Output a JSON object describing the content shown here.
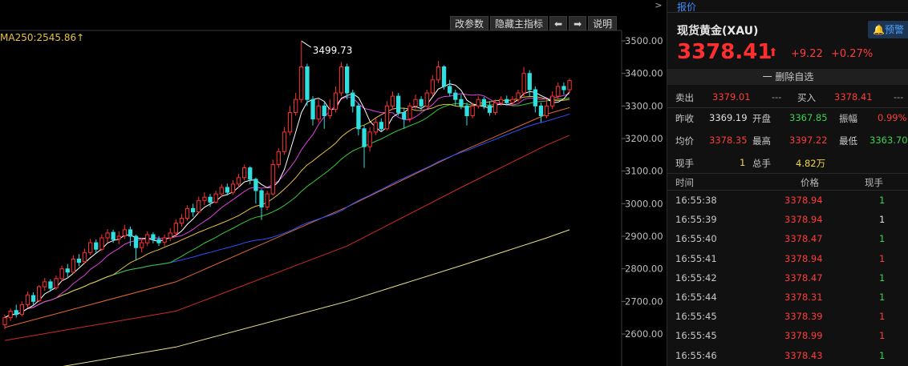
{
  "toolbar": {
    "buttons": [
      "改参数",
      "隐藏主指标",
      "⬅",
      "➡",
      "说明"
    ]
  },
  "ma_label": "MA250:2545.86↑",
  "max_label": "3499.73",
  "chart_data": {
    "type": "candlestick",
    "title": "",
    "yticks": [
      2600,
      2700,
      2800,
      2900,
      3000,
      3100,
      3200,
      3300,
      3400,
      3500
    ],
    "ylim": [
      2500,
      3540
    ],
    "max_marker": 3499.73,
    "candles": [
      [
        2628,
        2650,
        2615,
        2660
      ],
      [
        2650,
        2670,
        2640,
        2678
      ],
      [
        2672,
        2660,
        2650,
        2690
      ],
      [
        2660,
        2690,
        2655,
        2700
      ],
      [
        2690,
        2720,
        2680,
        2730
      ],
      [
        2718,
        2700,
        2690,
        2728
      ],
      [
        2702,
        2745,
        2698,
        2750
      ],
      [
        2745,
        2760,
        2732,
        2772
      ],
      [
        2760,
        2740,
        2730,
        2768
      ],
      [
        2742,
        2770,
        2735,
        2780
      ],
      [
        2770,
        2800,
        2762,
        2810
      ],
      [
        2800,
        2790,
        2775,
        2815
      ],
      [
        2790,
        2830,
        2785,
        2842
      ],
      [
        2830,
        2820,
        2808,
        2845
      ],
      [
        2822,
        2850,
        2815,
        2862
      ],
      [
        2850,
        2880,
        2842,
        2892
      ],
      [
        2880,
        2860,
        2850,
        2890
      ],
      [
        2860,
        2895,
        2855,
        2905
      ],
      [
        2895,
        2910,
        2880,
        2922
      ],
      [
        2912,
        2890,
        2880,
        2920
      ],
      [
        2892,
        2900,
        2875,
        2915
      ],
      [
        2902,
        2920,
        2892,
        2935
      ],
      [
        2920,
        2900,
        2870,
        2930
      ],
      [
        2900,
        2865,
        2825,
        2905
      ],
      [
        2865,
        2880,
        2850,
        2895
      ],
      [
        2880,
        2905,
        2870,
        2915
      ],
      [
        2905,
        2890,
        2878,
        2912
      ],
      [
        2890,
        2880,
        2870,
        2900
      ],
      [
        2882,
        2895,
        2870,
        2905
      ],
      [
        2895,
        2910,
        2885,
        2925
      ],
      [
        2910,
        2940,
        2900,
        2952
      ],
      [
        2940,
        2955,
        2930,
        2968
      ],
      [
        2955,
        2985,
        2948,
        2995
      ],
      [
        2985,
        2975,
        2960,
        3000
      ],
      [
        2975,
        3010,
        2970,
        3022
      ],
      [
        3010,
        3020,
        2995,
        3035
      ],
      [
        3020,
        3005,
        2990,
        3030
      ],
      [
        3005,
        3030,
        3000,
        3040
      ],
      [
        3030,
        3050,
        3020,
        3060
      ],
      [
        3050,
        3035,
        3025,
        3062
      ],
      [
        3035,
        3060,
        3028,
        3072
      ],
      [
        3060,
        3080,
        3050,
        3092
      ],
      [
        3080,
        3110,
        3072,
        3120
      ],
      [
        3110,
        3075,
        3060,
        3115
      ],
      [
        3075,
        3040,
        3000,
        3080
      ],
      [
        3040,
        2990,
        2950,
        3045
      ],
      [
        2990,
        3030,
        2980,
        3040
      ],
      [
        3030,
        3120,
        3025,
        3135
      ],
      [
        3120,
        3160,
        3110,
        3170
      ],
      [
        3160,
        3220,
        3150,
        3235
      ],
      [
        3220,
        3280,
        3210,
        3300
      ],
      [
        3280,
        3320,
        3270,
        3340
      ],
      [
        3320,
        3420,
        3310,
        3499
      ],
      [
        3420,
        3320,
        3300,
        3430
      ],
      [
        3320,
        3260,
        3240,
        3330
      ],
      [
        3260,
        3300,
        3250,
        3320
      ],
      [
        3300,
        3270,
        3230,
        3310
      ],
      [
        3270,
        3290,
        3260,
        3320
      ],
      [
        3290,
        3340,
        3280,
        3360
      ],
      [
        3340,
        3420,
        3330,
        3435
      ],
      [
        3420,
        3340,
        3320,
        3430
      ],
      [
        3340,
        3300,
        3280,
        3350
      ],
      [
        3300,
        3230,
        3210,
        3310
      ],
      [
        3230,
        3175,
        3110,
        3240
      ],
      [
        3175,
        3220,
        3160,
        3235
      ],
      [
        3220,
        3250,
        3210,
        3262
      ],
      [
        3250,
        3230,
        3220,
        3262
      ],
      [
        3230,
        3300,
        3225,
        3315
      ],
      [
        3300,
        3330,
        3290,
        3345
      ],
      [
        3330,
        3280,
        3270,
        3340
      ],
      [
        3280,
        3260,
        3230,
        3295
      ],
      [
        3260,
        3300,
        3250,
        3310
      ],
      [
        3300,
        3320,
        3290,
        3335
      ],
      [
        3320,
        3300,
        3288,
        3330
      ],
      [
        3300,
        3340,
        3295,
        3350
      ],
      [
        3340,
        3380,
        3330,
        3395
      ],
      [
        3380,
        3420,
        3370,
        3438
      ],
      [
        3420,
        3360,
        3350,
        3425
      ],
      [
        3360,
        3340,
        3330,
        3380
      ],
      [
        3340,
        3320,
        3300,
        3350
      ],
      [
        3320,
        3300,
        3290,
        3335
      ],
      [
        3300,
        3270,
        3240,
        3310
      ],
      [
        3270,
        3300,
        3262,
        3310
      ],
      [
        3300,
        3320,
        3292,
        3330
      ],
      [
        3320,
        3300,
        3290,
        3328
      ],
      [
        3300,
        3280,
        3270,
        3315
      ],
      [
        3280,
        3310,
        3272,
        3320
      ],
      [
        3310,
        3320,
        3300,
        3330
      ],
      [
        3320,
        3310,
        3302,
        3332
      ],
      [
        3310,
        3320,
        3302,
        3330
      ],
      [
        3320,
        3340,
        3312,
        3350
      ],
      [
        3340,
        3400,
        3330,
        3420
      ],
      [
        3400,
        3350,
        3330,
        3410
      ],
      [
        3350,
        3300,
        3280,
        3360
      ],
      [
        3300,
        3270,
        3250,
        3310
      ],
      [
        3270,
        3300,
        3262,
        3320
      ],
      [
        3300,
        3330,
        3290,
        3345
      ],
      [
        3330,
        3360,
        3320,
        3372
      ],
      [
        3360,
        3350,
        3335,
        3372
      ],
      [
        3350,
        3378,
        3340,
        3385
      ]
    ],
    "ma_lines": [
      {
        "color": "#ffffff",
        "period": 5
      },
      {
        "color": "#f0c040",
        "period": 10
      },
      {
        "color": "#e040e0",
        "period": 20
      },
      {
        "color": "#40e040",
        "period": 30
      },
      {
        "color": "#4060ff",
        "period": 60
      },
      {
        "color": "#ff8040",
        "period": 120
      },
      {
        "color": "#ff3030",
        "period": 180
      },
      {
        "color": "#ffff80",
        "period": 250
      }
    ],
    "long_ma": {
      "orange_120": [
        [
          0,
          2620
        ],
        [
          30,
          2760
        ],
        [
          60,
          2990
        ],
        [
          80,
          3160
        ],
        [
          95,
          3275
        ],
        [
          99,
          3295
        ]
      ],
      "red_180": [
        [
          0,
          2580
        ],
        [
          30,
          2670
        ],
        [
          60,
          2870
        ],
        [
          80,
          3050
        ],
        [
          95,
          3180
        ],
        [
          99,
          3210
        ]
      ],
      "yellow_250": [
        [
          0,
          2470
        ],
        [
          30,
          2560
        ],
        [
          60,
          2700
        ],
        [
          80,
          2810
        ],
        [
          95,
          2895
        ],
        [
          99,
          2920
        ]
      ]
    }
  },
  "panel": {
    "tab": "报价",
    "title": "现货黄金(XAU)",
    "alert_label": "预警",
    "price": "3378.41",
    "change": "+9.22",
    "change_pct": "+0.27%",
    "remove_label": "一 删除自选",
    "sell_label": "卖出",
    "sell_value": "3379.01",
    "sell_vol": "---",
    "buy_label": "买入",
    "buy_value": "3378.41",
    "buy_vol": "---",
    "prev_close_label": "昨收",
    "prev_close": "3369.19",
    "open_label": "开盘",
    "open": "3367.85",
    "amp_label": "振幅",
    "amp": "0.99%",
    "avg_label": "均价",
    "avg": "3378.35",
    "high_label": "最高",
    "high": "3397.22",
    "low_label": "最低",
    "low": "3363.70",
    "cur_vol_label": "现手",
    "cur_vol": "1",
    "total_label": "总手",
    "total": "4.82万",
    "tick_headers": [
      "时间",
      "价格",
      "现手"
    ],
    "ticks": [
      {
        "time": "16:55:38",
        "price": "3378.94",
        "vol": "1",
        "dir": "green"
      },
      {
        "time": "16:55:39",
        "price": "3378.94",
        "vol": "1",
        "dir": "white"
      },
      {
        "time": "16:55:40",
        "price": "3378.47",
        "vol": "1",
        "dir": "green"
      },
      {
        "time": "16:55:41",
        "price": "3378.94",
        "vol": "1",
        "dir": "red"
      },
      {
        "time": "16:55:42",
        "price": "3378.47",
        "vol": "1",
        "dir": "green"
      },
      {
        "time": "16:55:44",
        "price": "3378.31",
        "vol": "1",
        "dir": "green"
      },
      {
        "time": "16:55:45",
        "price": "3378.39",
        "vol": "1",
        "dir": "red"
      },
      {
        "time": "16:55:45",
        "price": "3378.99",
        "vol": "1",
        "dir": "red"
      },
      {
        "time": "16:55:46",
        "price": "3378.43",
        "vol": "1",
        "dir": "green"
      }
    ]
  }
}
